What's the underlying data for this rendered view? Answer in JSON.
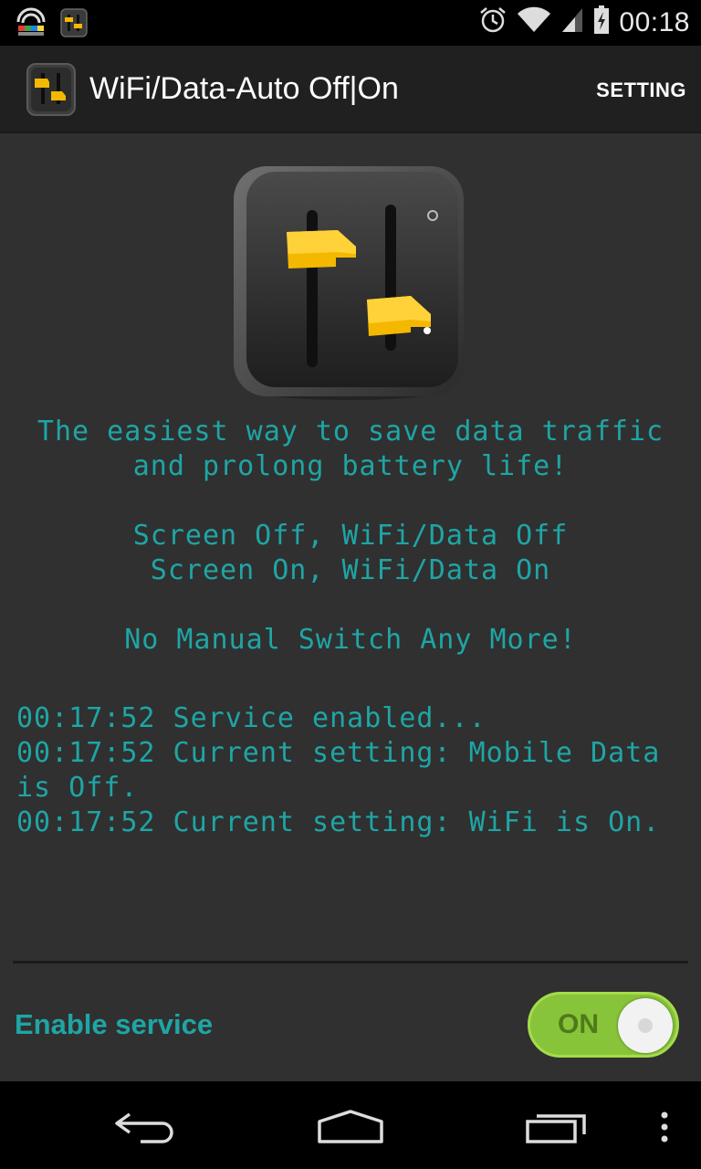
{
  "status_bar": {
    "time": "00:18",
    "icons": [
      "wifi-ap-icon",
      "app-notification-icon",
      "alarm-icon",
      "wifi-signal-icon",
      "cell-signal-icon",
      "battery-charging-icon"
    ]
  },
  "action_bar": {
    "title": "WiFi/Data-Auto Off|On",
    "setting_label": "SETTING"
  },
  "main": {
    "tagline_1": "The easiest way to save data traffic\nand prolong battery life!",
    "tagline_2": "Screen Off, WiFi/Data Off\nScreen On, WiFi/Data On",
    "tagline_3": "No Manual Switch Any More!",
    "log": [
      "00:17:52 Service enabled...",
      "00:17:52 Current setting: Mobile Data is Off.",
      "00:17:52 Current setting: WiFi is On."
    ]
  },
  "service": {
    "label": "Enable service",
    "toggle_state": "ON"
  },
  "colors": {
    "accent_teal": "#1fa5a5",
    "toggle_green": "#88c43a",
    "background": "#303030"
  },
  "nav_bar": {
    "icons": [
      "back-icon",
      "home-icon",
      "recent-apps-icon",
      "overflow-menu-icon"
    ]
  }
}
